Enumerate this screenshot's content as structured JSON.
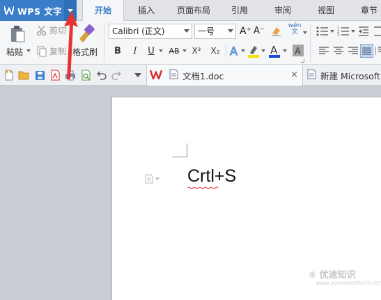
{
  "app": {
    "title": "WPS 文字"
  },
  "tabs": [
    {
      "label": "开始",
      "active": true
    },
    {
      "label": "插入"
    },
    {
      "label": "页面布局"
    },
    {
      "label": "引用"
    },
    {
      "label": "审阅"
    },
    {
      "label": "视图"
    },
    {
      "label": "章节"
    }
  ],
  "ribbon": {
    "paste_label": "粘贴",
    "cut_label": "剪切",
    "copy_label": "复制",
    "format_painter_label": "格式刷",
    "font_name": "Calibri (正文)",
    "font_size": "一号",
    "bold": "B",
    "italic": "I",
    "underline": "U",
    "strike": "AB",
    "superscript": "X²",
    "subscript": "X₂",
    "grow_font": "A⁺",
    "shrink_font": "A⁻",
    "phonetic": "wén 文"
  },
  "quickbar": {
    "doc_tabs": [
      {
        "label": "文档1.doc",
        "active": true
      },
      {
        "label": "新建 Microsoft"
      }
    ],
    "close_glyph": "×"
  },
  "document": {
    "text": "Crtl+S"
  },
  "watermark": {
    "text": "⑤ 优速知识",
    "sub": "www.youxuanzhishi.com"
  },
  "colors": {
    "app_blue": "#3a7ec9",
    "highlight_yellow": "#f5e400",
    "font_color_blue": "#1a4bd6",
    "arrow_red": "#e8322f",
    "wps_red": "#d9282d"
  }
}
